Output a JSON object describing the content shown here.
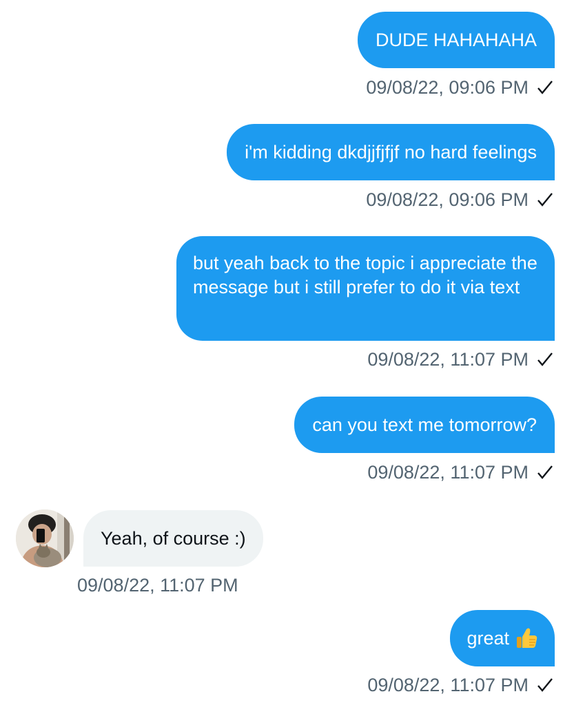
{
  "messages": [
    {
      "text": "DUDE HAHAHAHA",
      "timestamp": "09/08/22, 09:06 PM",
      "direction": "outgoing",
      "status_icon": "checkmark-icon"
    },
    {
      "text": "i'm kidding dkdjjfjfjf no hard feelings",
      "timestamp": "09/08/22, 09:06 PM",
      "direction": "outgoing",
      "status_icon": "checkmark-icon"
    },
    {
      "text": "but yeah back to the topic i appreciate the message but i still prefer to do it via text",
      "timestamp": "09/08/22, 11:07 PM",
      "direction": "outgoing",
      "status_icon": "checkmark-icon"
    },
    {
      "text": "can you text me tomorrow?",
      "timestamp": "09/08/22, 11:07 PM",
      "direction": "outgoing",
      "status_icon": "checkmark-icon"
    },
    {
      "text": "Yeah, of course :)",
      "timestamp": "09/08/22, 11:07 PM",
      "direction": "incoming",
      "avatar_icon": "avatar"
    },
    {
      "text": "great",
      "emoji": "thumbs-up-icon",
      "timestamp": "09/08/22, 11:07 PM",
      "direction": "outgoing",
      "status_icon": "checkmark-icon"
    }
  ],
  "colors": {
    "outgoing_bubble": "#1d9bf0",
    "incoming_bubble": "#eff3f4",
    "timestamp_text": "#536471",
    "incoming_text": "#0f1419"
  }
}
